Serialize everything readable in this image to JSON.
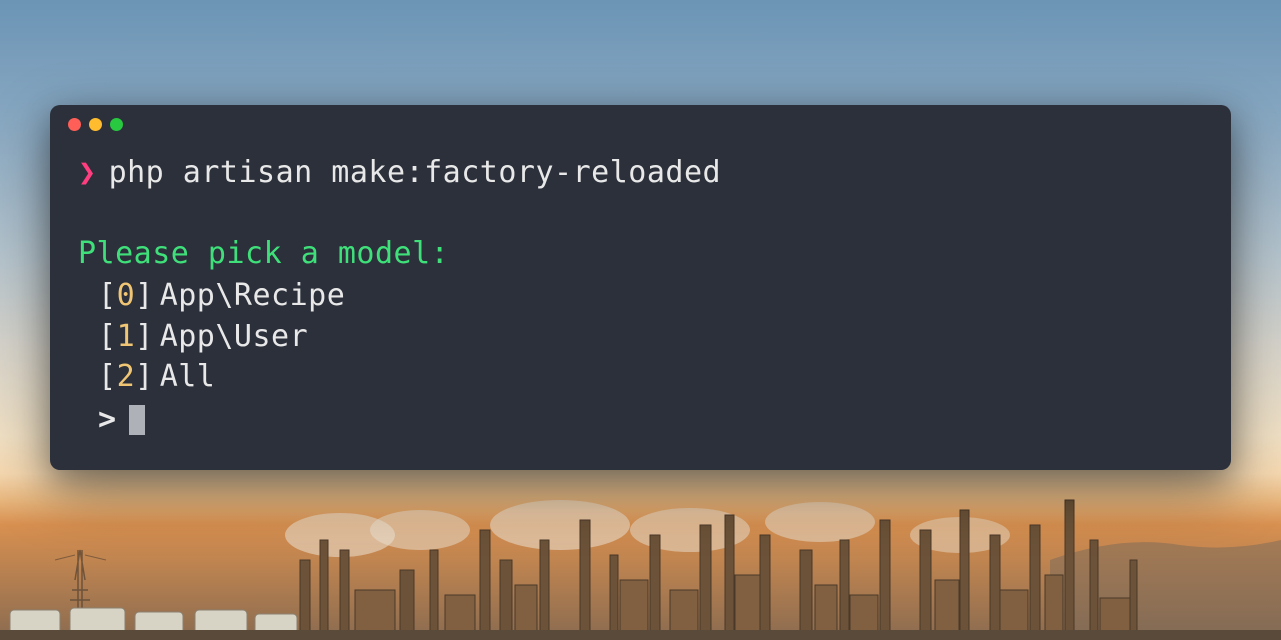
{
  "terminal": {
    "prompt_symbol": "❯",
    "command": "php artisan make:factory-reloaded",
    "question": "Please pick a model:",
    "options": [
      {
        "index": "0",
        "label": "App\\Recipe"
      },
      {
        "index": "1",
        "label": "App\\User"
      },
      {
        "index": "2",
        "label": "All"
      }
    ],
    "input_prompt": ">"
  }
}
